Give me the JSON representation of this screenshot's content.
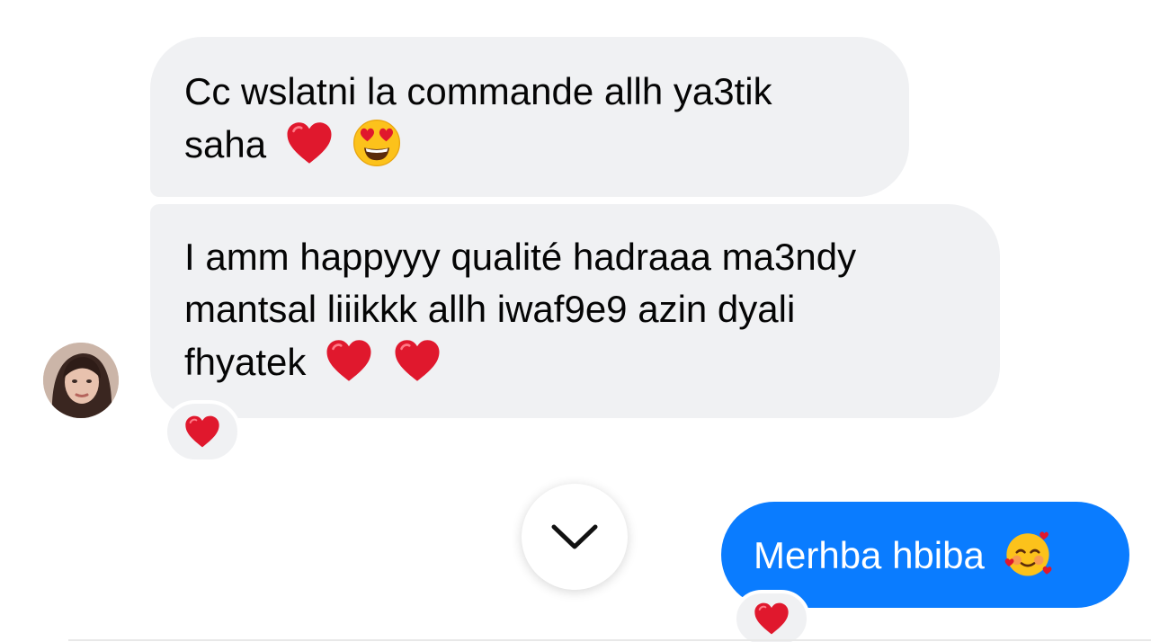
{
  "conversation": {
    "messages": [
      {
        "direction": "incoming",
        "line1": "Cc wslatni la commande allh ya3tik",
        "line2": "saha",
        "emojis": [
          "red-heart",
          "heart-eyes-face"
        ]
      },
      {
        "direction": "incoming",
        "line1": "I amm happyyy qualité hadraaa ma3ndy",
        "line2": "mantsal liiikkk allh iwaf9e9 azin dyali",
        "line3": "fhyatek",
        "emojis": [
          "red-heart",
          "red-heart"
        ],
        "reaction": "red-heart"
      },
      {
        "direction": "outgoing",
        "text": "Merhba hbiba",
        "emojis": [
          "smiling-face-with-hearts"
        ],
        "reaction": "red-heart"
      }
    ]
  },
  "colors": {
    "incoming_bubble": "#f0f1f3",
    "outgoing_bubble": "#0a7cff",
    "incoming_text": "#050505",
    "outgoing_text": "#ffffff",
    "heart": "#e0182d"
  },
  "icons": {
    "scroll_down": "chevron-down-icon",
    "avatar": "contact-avatar"
  }
}
